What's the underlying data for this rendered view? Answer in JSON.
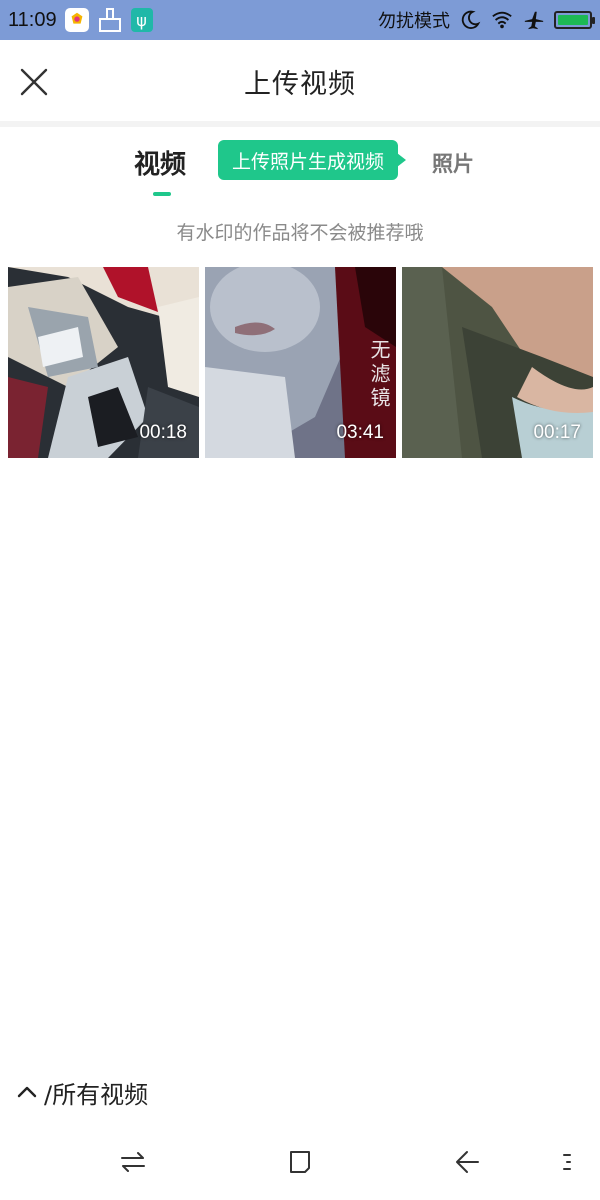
{
  "status_bar": {
    "time": "11:09",
    "dnd_label": "勿扰模式",
    "battery_level": 1.0,
    "icons": [
      "app-badge-icon",
      "clean-icon",
      "usb-icon",
      "moon-icon",
      "wifi-icon",
      "airplane-icon",
      "battery-icon"
    ]
  },
  "header": {
    "title": "上传视频",
    "close_icon": "close-icon"
  },
  "tabs": {
    "video_label": "视频",
    "promo_label": "上传照片生成视频",
    "photo_label": "照片",
    "active": "video"
  },
  "note": "有水印的作品将不会被推荐哦",
  "videos": [
    {
      "duration": "00:18"
    },
    {
      "duration": "03:41"
    },
    {
      "duration": "00:17"
    }
  ],
  "thumb2_overlay": "无滤镜",
  "album": {
    "label": "/所有视频",
    "icon": "chevron-up-icon"
  },
  "nav": {
    "icons": [
      "switch-icon",
      "home-icon",
      "back-icon",
      "menu-icon"
    ]
  },
  "colors": {
    "accent": "#1fc78b",
    "status_bar_bg": "#7d9bd6"
  }
}
